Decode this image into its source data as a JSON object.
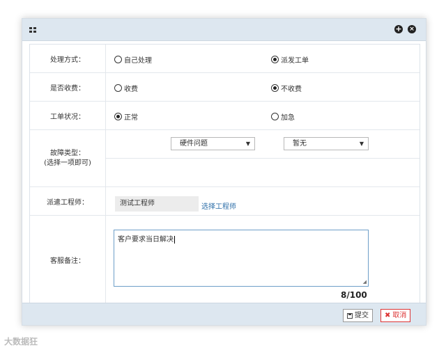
{
  "form": {
    "handling": {
      "label": "处理方式：",
      "opt1": "自己处理",
      "opt2": "派发工单",
      "selected": "派发工单"
    },
    "fee": {
      "label": "是否收费：",
      "opt1": "收费",
      "opt2": "不收费",
      "selected": "不收费"
    },
    "status": {
      "label": "工单状况：",
      "opt1": "正常",
      "opt2": "加急",
      "selected": "正常"
    },
    "fault": {
      "label": "故障类型：\n(选择一项即可)",
      "select1": "硬件问题",
      "select2": "暂无"
    },
    "engineer": {
      "label": "派遣工程师：",
      "value": "测试工程师",
      "link": "选择工程师"
    },
    "remarks": {
      "label": "客服备注：",
      "value": "客户要求当日解决",
      "count": "8/100"
    }
  },
  "buttons": {
    "submit": "提交",
    "cancel": "取消"
  },
  "watermark": "大数据狂"
}
